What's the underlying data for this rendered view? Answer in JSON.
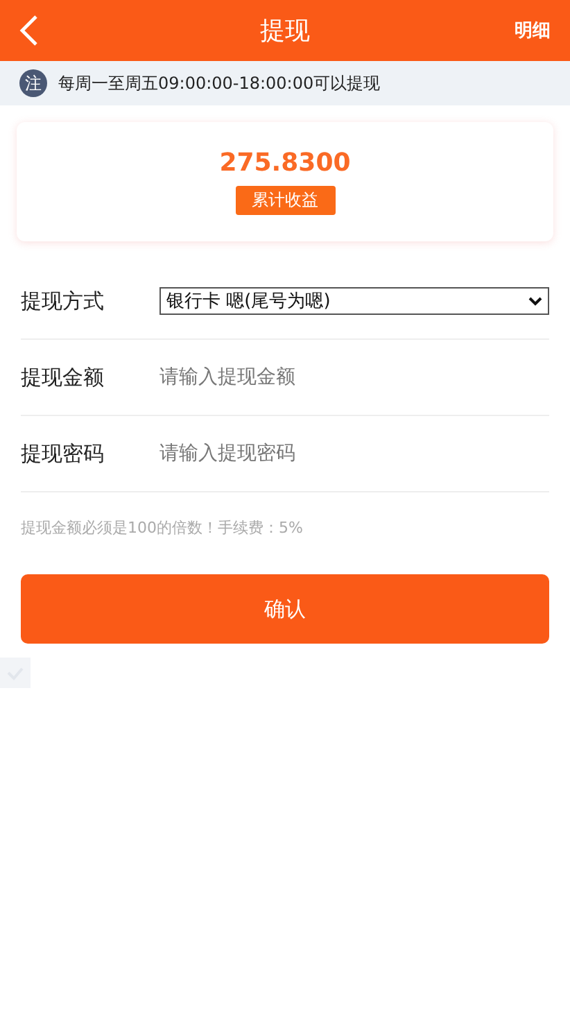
{
  "header": {
    "title": "提现",
    "action": "明细"
  },
  "notice": {
    "badge": "注",
    "text": "每周一至周五09:00:00-18:00:00可以提现"
  },
  "summary": {
    "amount": "275.8300",
    "label": "累计收益"
  },
  "form": [
    {
      "kind": "select",
      "label": "提现方式",
      "value": "银行卡 嗯(尾号为嗯)"
    },
    {
      "kind": "input",
      "label": "提现金额",
      "placeholder": "请输入提现金额"
    },
    {
      "kind": "input",
      "label": "提现密码",
      "placeholder": "请输入提现密码"
    }
  ],
  "hint": "提现金额必须是100的倍数！手续费：5%",
  "submit": "确认"
}
